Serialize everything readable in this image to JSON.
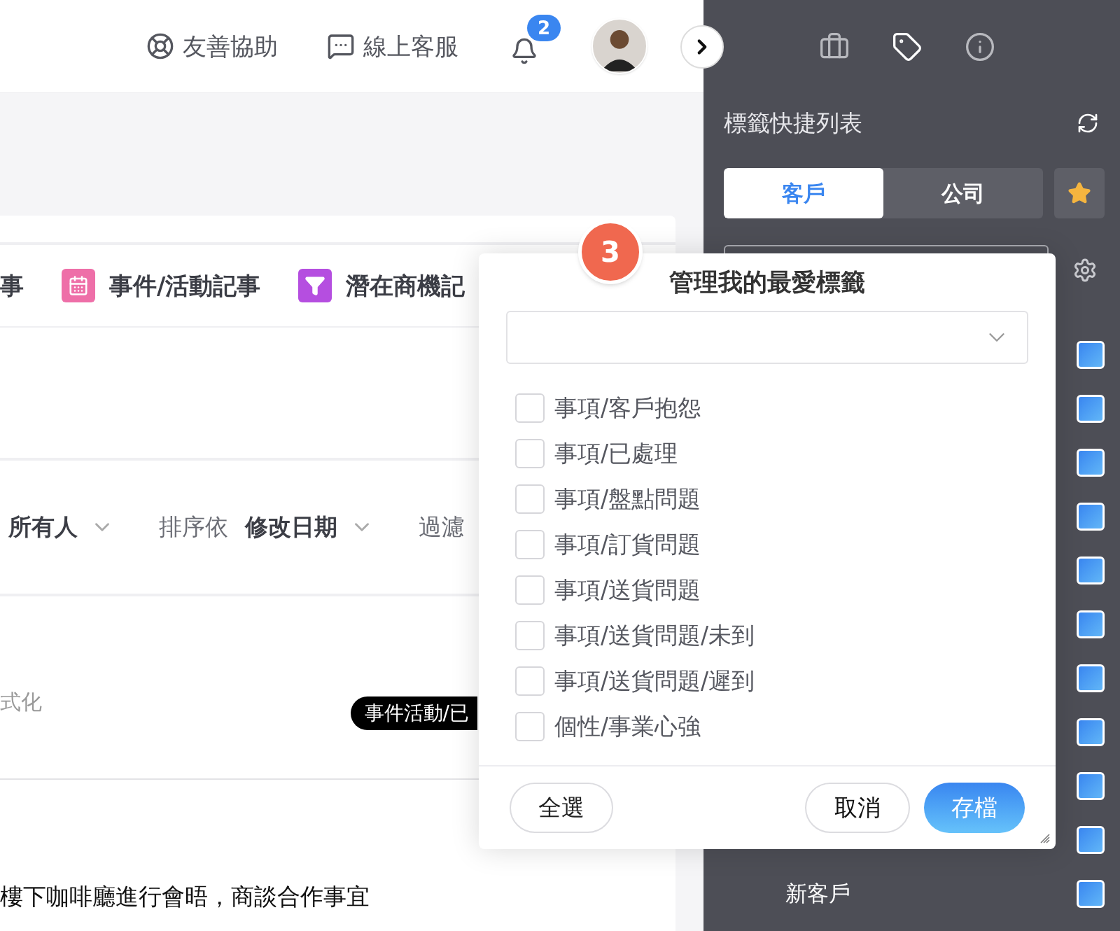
{
  "top_bar": {
    "links": [
      {
        "kind": "help",
        "label": "友善協助"
      },
      {
        "kind": "support",
        "label": "線上客服"
      }
    ],
    "notification_count": "2"
  },
  "main": {
    "tabs": [
      {
        "kind": "none",
        "label": "事"
      },
      {
        "kind": "calendar",
        "label": "事件/活動記事",
        "color": "#ee6fa8"
      },
      {
        "kind": "funnel",
        "label": "潛在商機記",
        "color": "#b54ee0"
      }
    ],
    "filters": [
      {
        "kind": "select",
        "text": "所有人"
      },
      {
        "kind": "label",
        "text": "排序依"
      },
      {
        "kind": "select",
        "text": "修改日期"
      },
      {
        "kind": "label",
        "text": "過濾"
      }
    ],
    "records": [
      {
        "kind": "note",
        "text": "式化",
        "tag": "事件活動/已"
      },
      {
        "kind": "title",
        "text": "樓下咖啡廳進行會晤，商談合作事宜"
      }
    ]
  },
  "sidebar": {
    "title": "標籤快捷列表",
    "tabs": [
      {
        "label": "客戶",
        "selected": true
      },
      {
        "label": "公司",
        "selected": false
      }
    ],
    "rows": [
      {
        "checked": true
      },
      {
        "checked": true
      },
      {
        "checked": true
      },
      {
        "checked": true
      },
      {
        "checked": true
      },
      {
        "checked": true
      },
      {
        "checked": true
      },
      {
        "checked": true
      },
      {
        "checked": true
      },
      {
        "checked": true
      },
      {
        "checked": true,
        "label": "新客戶"
      }
    ]
  },
  "dialog": {
    "step": "3",
    "title": "管理我的最愛標籤",
    "options": [
      {
        "label": "事項/客戶抱怨",
        "checked": false
      },
      {
        "label": "事項/已處理",
        "checked": false
      },
      {
        "label": "事項/盤點問題",
        "checked": false
      },
      {
        "label": "事項/訂貨問題",
        "checked": false
      },
      {
        "label": "事項/送貨問題",
        "checked": false
      },
      {
        "label": "事項/送貨問題/未到",
        "checked": false
      },
      {
        "label": "事項/送貨問題/遲到",
        "checked": false
      },
      {
        "label": "個性/事業心強",
        "checked": false
      }
    ],
    "select_all": "全選",
    "actions": [
      {
        "kind": "secondary",
        "label": "取消"
      },
      {
        "kind": "primary",
        "label": "存檔"
      }
    ]
  }
}
